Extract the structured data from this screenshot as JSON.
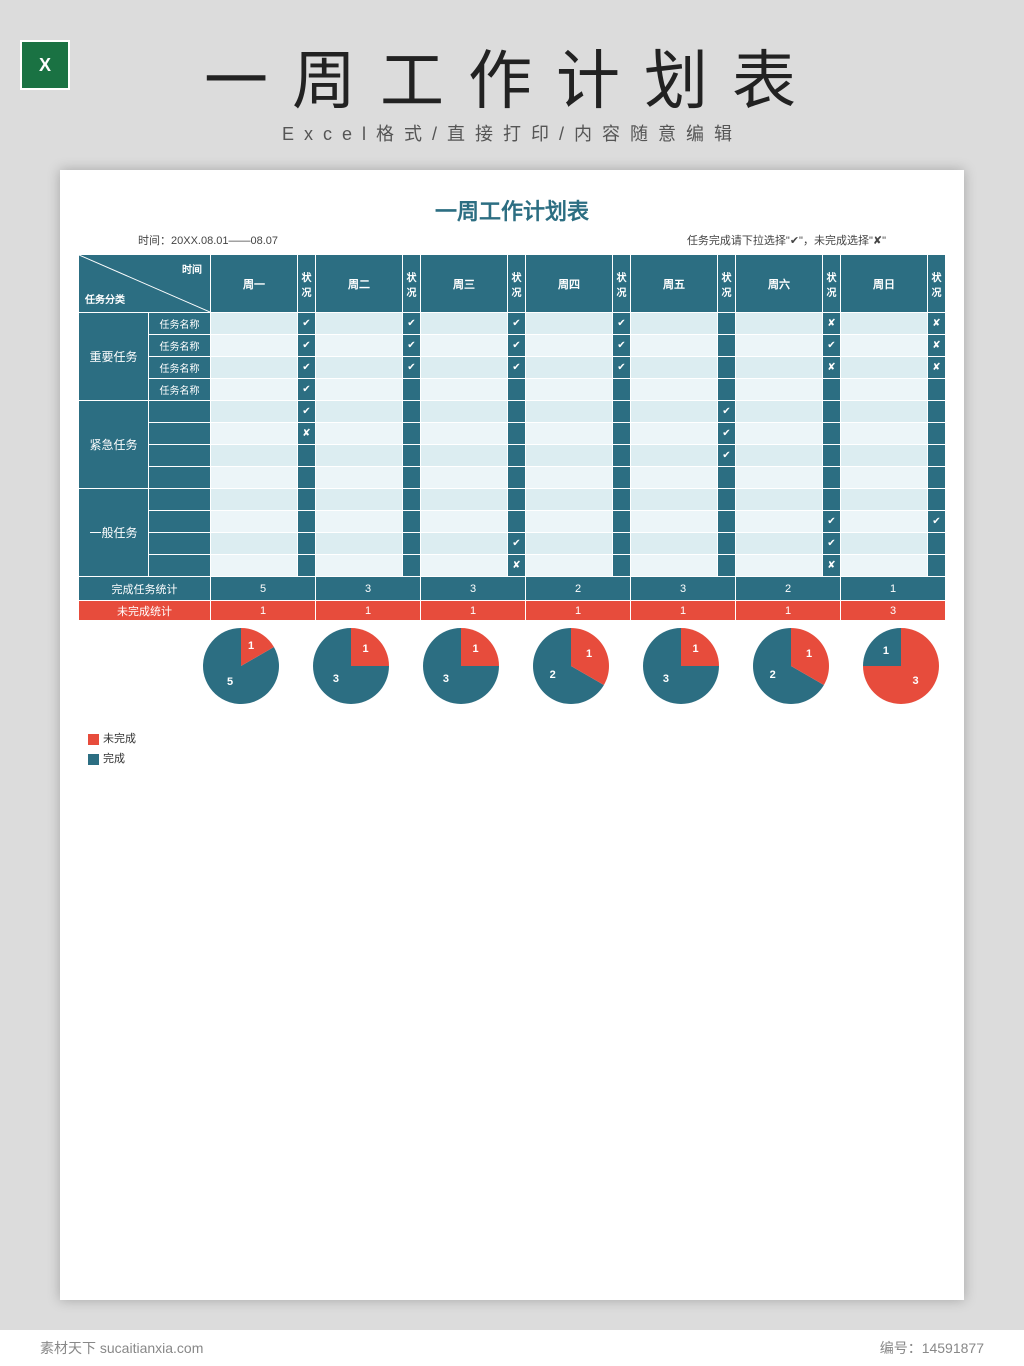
{
  "header": {
    "big_title": "一周工作计划表",
    "sub_title": "Excel格式/直接打印/内容随意编辑",
    "icon_letter": "X"
  },
  "sheet": {
    "title": "一周工作计划表",
    "date_range": "时间：20XX.08.01——08.07",
    "instruction": "任务完成请下拉选择\"✔\"，未完成选择\"✘\"",
    "diag_label_time": "时间",
    "diag_label_cat": "任务分类",
    "status_header": "状况",
    "days": [
      "周一",
      "周二",
      "周三",
      "周四",
      "周五",
      "周六",
      "周日"
    ],
    "categories": [
      {
        "name": "重要任务",
        "rows": 4
      },
      {
        "name": "紧急任务",
        "rows": 4
      },
      {
        "name": "一般任务",
        "rows": 4
      }
    ],
    "task_label": "任务名称",
    "checkmarks": {
      "重要任务": [
        [
          "✔",
          "✔",
          "✔",
          "✔",
          "",
          "✘",
          "✘"
        ],
        [
          "✔",
          "✔",
          "✔",
          "✔",
          "",
          "✔",
          "✘"
        ],
        [
          "✔",
          "✔",
          "✔",
          "✔",
          "",
          "✘",
          "✘"
        ],
        [
          "✔",
          "",
          "",
          "",
          "",
          "",
          ""
        ]
      ],
      "紧急任务": [
        [
          "✔",
          "",
          "",
          "",
          "✔",
          "",
          ""
        ],
        [
          "✘",
          "",
          "",
          "",
          "✔",
          "",
          ""
        ],
        [
          "",
          "",
          "",
          "",
          "✔",
          "",
          ""
        ],
        [
          "",
          "",
          "",
          "",
          "",
          "",
          ""
        ]
      ],
      "一般任务": [
        [
          "",
          "",
          "",
          "",
          "",
          "",
          ""
        ],
        [
          "",
          "",
          "",
          "",
          "",
          "✔",
          "✔"
        ],
        [
          "",
          "",
          "✔",
          "",
          "",
          "✔",
          ""
        ],
        [
          "",
          "",
          "✘",
          "",
          "",
          "✘",
          ""
        ]
      ]
    },
    "summary": {
      "completed_label": "完成任务统计",
      "completed": [
        5,
        3,
        3,
        2,
        3,
        2,
        1
      ],
      "incomplete_label": "未完成统计",
      "incomplete": [
        1,
        1,
        1,
        1,
        1,
        1,
        3
      ]
    }
  },
  "legend": {
    "incomplete": "未完成",
    "complete": "完成"
  },
  "chart_data": [
    {
      "type": "pie",
      "series": [
        {
          "name": "未完成",
          "value": 1
        },
        {
          "name": "完成",
          "value": 5
        }
      ]
    },
    {
      "type": "pie",
      "series": [
        {
          "name": "未完成",
          "value": 1
        },
        {
          "name": "完成",
          "value": 3
        }
      ]
    },
    {
      "type": "pie",
      "series": [
        {
          "name": "未完成",
          "value": 1
        },
        {
          "name": "完成",
          "value": 3
        }
      ]
    },
    {
      "type": "pie",
      "series": [
        {
          "name": "未完成",
          "value": 1
        },
        {
          "name": "完成",
          "value": 2
        }
      ]
    },
    {
      "type": "pie",
      "series": [
        {
          "name": "未完成",
          "value": 1
        },
        {
          "name": "完成",
          "value": 3
        }
      ]
    },
    {
      "type": "pie",
      "series": [
        {
          "name": "未完成",
          "value": 1
        },
        {
          "name": "完成",
          "value": 2
        }
      ]
    },
    {
      "type": "pie",
      "series": [
        {
          "name": "未完成",
          "value": 3
        },
        {
          "name": "完成",
          "value": 1
        }
      ]
    }
  ],
  "footer": {
    "left": "素材天下 sucaitianxia.com",
    "right_label": "编号：",
    "right_value": "14591877"
  },
  "colors": {
    "teal": "#2c6e82",
    "red": "#e74c3c"
  }
}
